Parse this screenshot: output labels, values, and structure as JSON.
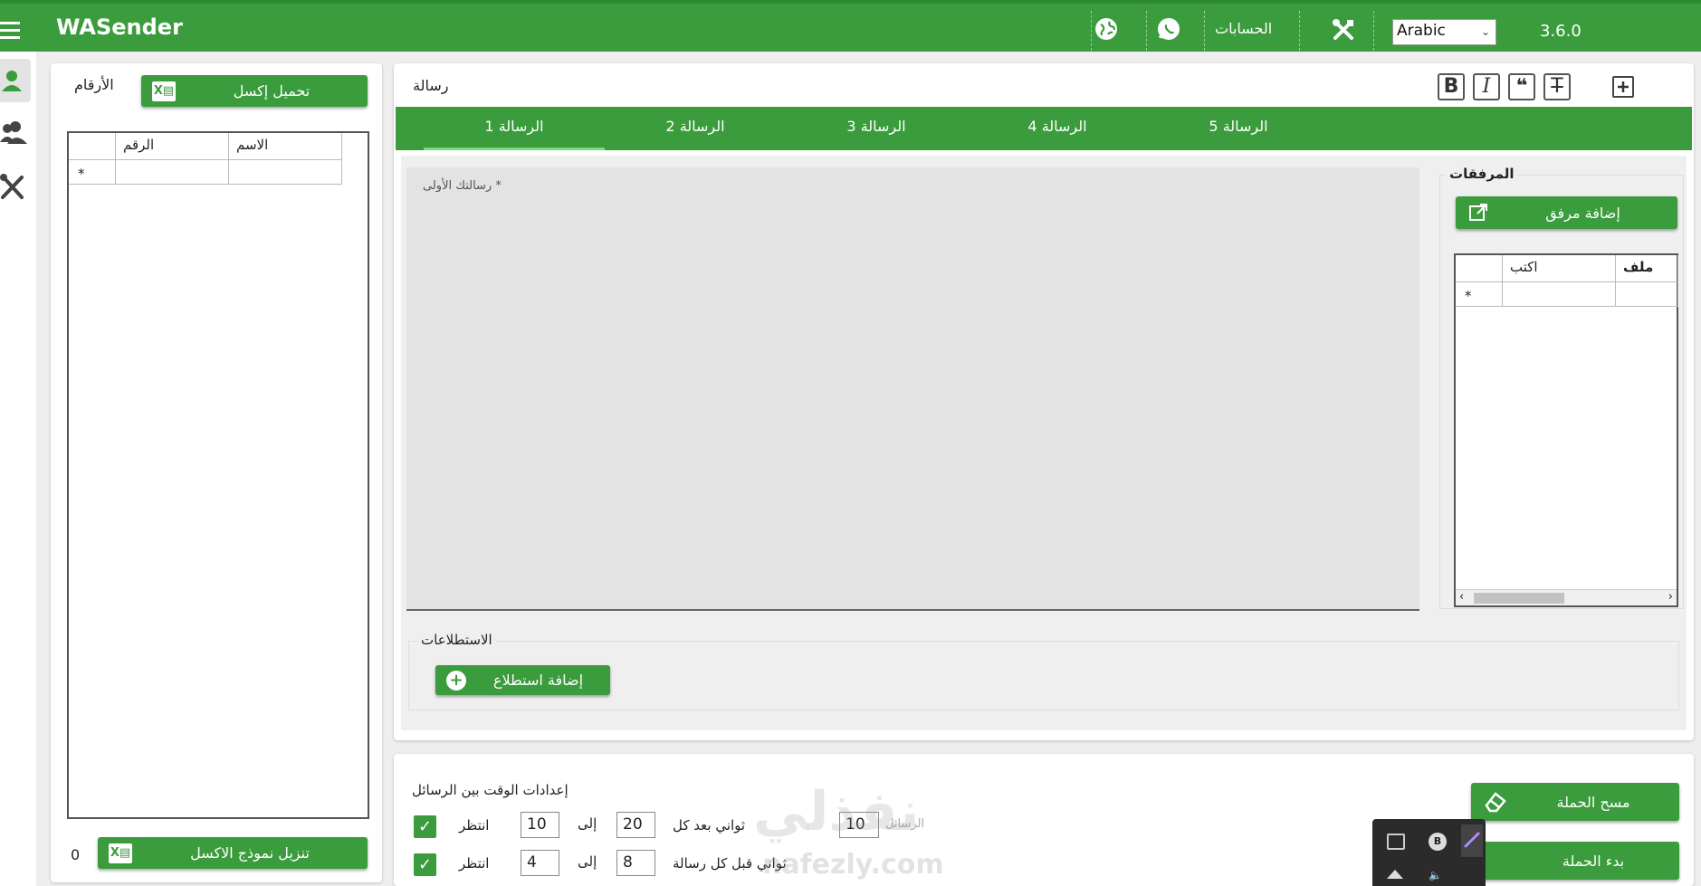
{
  "app": {
    "title": "WASender",
    "version": "3.6.0"
  },
  "topbar": {
    "accounts_label": "الحسابات",
    "language": "Arabic"
  },
  "numbers_panel": {
    "title": "الأرقام",
    "load_excel_label": "تحميل إكسل",
    "columns": [
      "الاسم",
      "الرقم"
    ],
    "new_row_marker": "*",
    "count": "0",
    "download_template_label": "تنزيل نموذج الاكسل"
  },
  "message_panel": {
    "title": "رسالة",
    "format_buttons": [
      "B",
      "I",
      "❝",
      "T"
    ],
    "tabs": [
      "الرسالة 1",
      "الرسالة 2",
      "الرسالة 3",
      "الرسالة 4",
      "الرسالة 5"
    ],
    "active_tab": 0,
    "textarea_placeholder": "رسالتك الأولى *",
    "attachments": {
      "title": "المرفقات",
      "add_label": "إضافة مرفق",
      "columns": [
        "ملف",
        "اكتب"
      ],
      "new_row_marker": "*"
    },
    "polls": {
      "title": "الاستطلاعات",
      "add_label": "إضافة استطلاع"
    }
  },
  "timing": {
    "title": "إعدادات الوقت بين الرسائل",
    "row1": {
      "wait": "انتظر",
      "from": "10",
      "to_word": "إلى",
      "to": "20",
      "unit": "ثواني بعد كل",
      "count": "10",
      "count_placeholder": "الرسائل"
    },
    "row2": {
      "wait": "انتظر",
      "from": "4",
      "to_word": "إلى",
      "to": "8",
      "unit": "ثواني قبل كل رسالة"
    }
  },
  "campaign": {
    "clear_label": "مسح الحملة",
    "start_label": "بدء الحملة"
  },
  "watermark": {
    "arabic": "نفذلي",
    "latin": "nafezly.com"
  },
  "colors": {
    "primary": "#3a9c3c",
    "background": "#eeeeee"
  }
}
